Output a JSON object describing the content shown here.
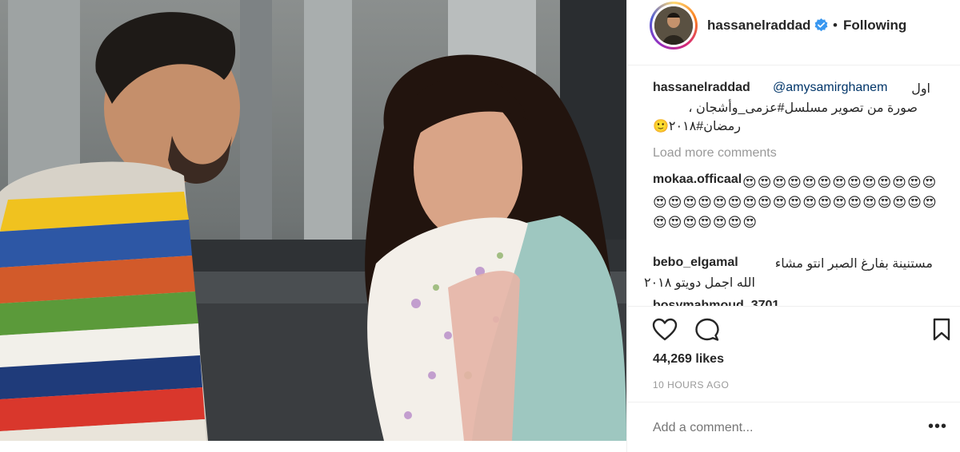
{
  "post": {
    "username": "hassanelraddad",
    "follow_status": "Following",
    "separator": "•",
    "likes": "44,269 likes",
    "timestamp": "10 HOURS AGO",
    "add_comment_placeholder": "Add a comment...",
    "more_options": "•••"
  },
  "caption": {
    "username": "hassanelraddad",
    "mention": "@amysamirghanem",
    "text_first": "اول",
    "text_line2": "صورة من تصوير مسلسل#عزمى_وأشجان ،",
    "text_line3": "رمضان#٢٠١٨🙂"
  },
  "load_more_label": "Load more comments",
  "comments": [
    {
      "username": "mokaa.officaal",
      "text": "😍😍😍😍😍😍😍😍😍😍😍😍😍😍😍😍😍😍😍😍😍😍😍😍😍😍😍😍😍😍😍😍😍😍😍😍😍😍😍"
    },
    {
      "username": "bebo_elgamal",
      "text_line1": "مستنينة بفارغ الصبر انتو مشاء",
      "text_line2": "الله اجمل دويتو ٢٠١٨"
    },
    {
      "username_partial": "bosymahmoud_3701"
    }
  ],
  "icons": {
    "like": "heart-icon",
    "comment": "comment-bubble-icon",
    "save": "bookmark-icon",
    "verified": "verified-badge-icon"
  },
  "colors": {
    "link": "#003569",
    "verified": "#3897f0",
    "muted": "#999999",
    "text": "#262626"
  }
}
